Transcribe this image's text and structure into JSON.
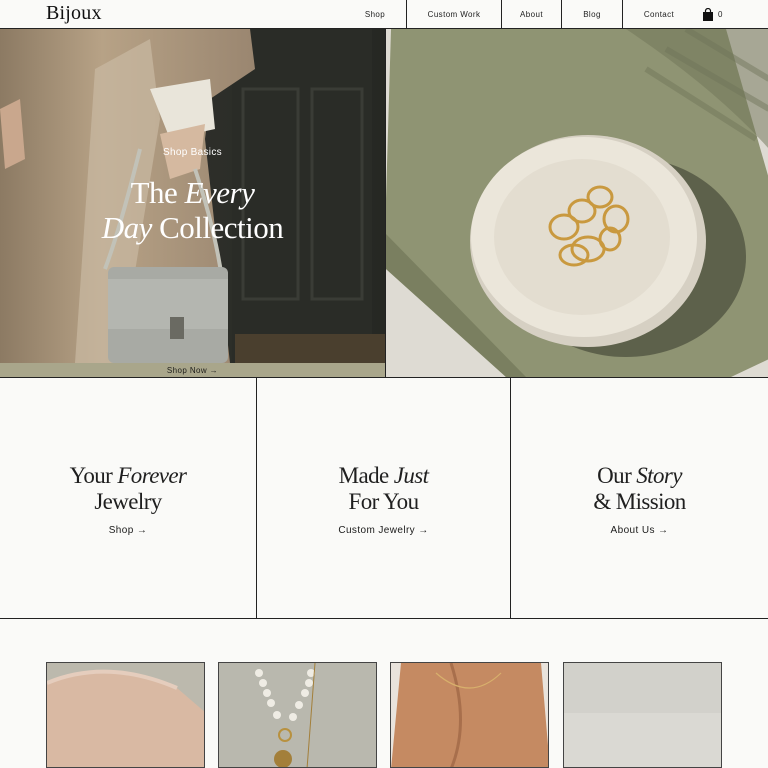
{
  "header": {
    "logo": "Bijoux",
    "nav": [
      {
        "label": "Shop"
      },
      {
        "label": "Custom Work"
      },
      {
        "label": "About"
      },
      {
        "label": "Blog"
      },
      {
        "label": "Contact"
      }
    ],
    "cart_count": "0"
  },
  "hero": {
    "eyebrow": "Shop Basics",
    "title_part1": "The ",
    "title_italic1": "Every",
    "title_italic2": "Day",
    "title_part2": " Collection",
    "cta": "Shop Now →"
  },
  "tiles": [
    {
      "pre": "Your ",
      "italic": "Forever",
      "line2": "Jewelry",
      "link": "Shop →"
    },
    {
      "pre": "Made ",
      "italic": "Just",
      "line2": "For You",
      "link": "Custom Jewelry →"
    },
    {
      "pre": "Our ",
      "italic": "Story",
      "line2": "& Mission",
      "link": "About Us →"
    }
  ],
  "colors": {
    "accent_bar": "#a9a68b",
    "border": "#222222",
    "background": "#fafaf8"
  }
}
